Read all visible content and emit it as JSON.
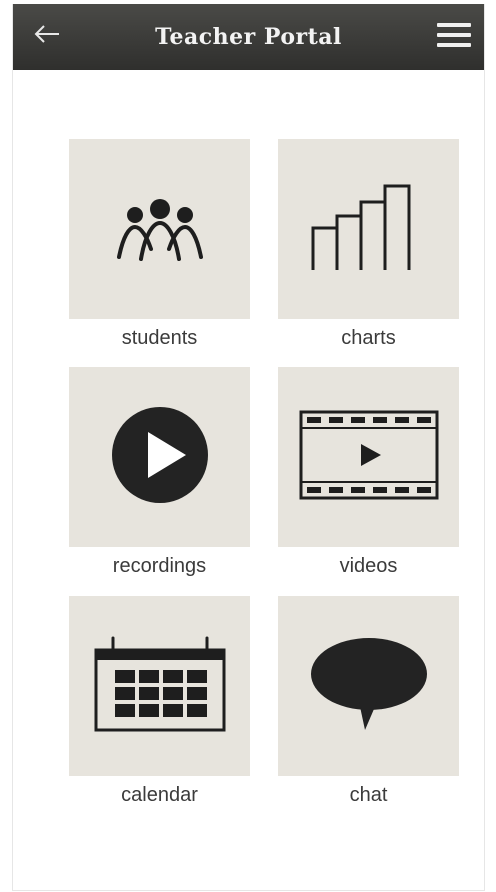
{
  "header": {
    "title": "Teacher Portal",
    "back_icon": "arrow-left-icon",
    "menu_icon": "hamburger-menu-icon"
  },
  "tiles": [
    {
      "label": "students",
      "icon": "people-group-icon"
    },
    {
      "label": "charts",
      "icon": "bar-chart-icon"
    },
    {
      "label": "recordings",
      "icon": "play-circle-icon"
    },
    {
      "label": "videos",
      "icon": "film-strip-icon"
    },
    {
      "label": "calendar",
      "icon": "calendar-icon"
    },
    {
      "label": "chat",
      "icon": "speech-bubble-icon"
    }
  ],
  "colors": {
    "header_bg": "#3b3b39",
    "tile_bg": "#e7e4dd",
    "icon": "#1e1e1e",
    "label_text": "#3b3b3b"
  }
}
